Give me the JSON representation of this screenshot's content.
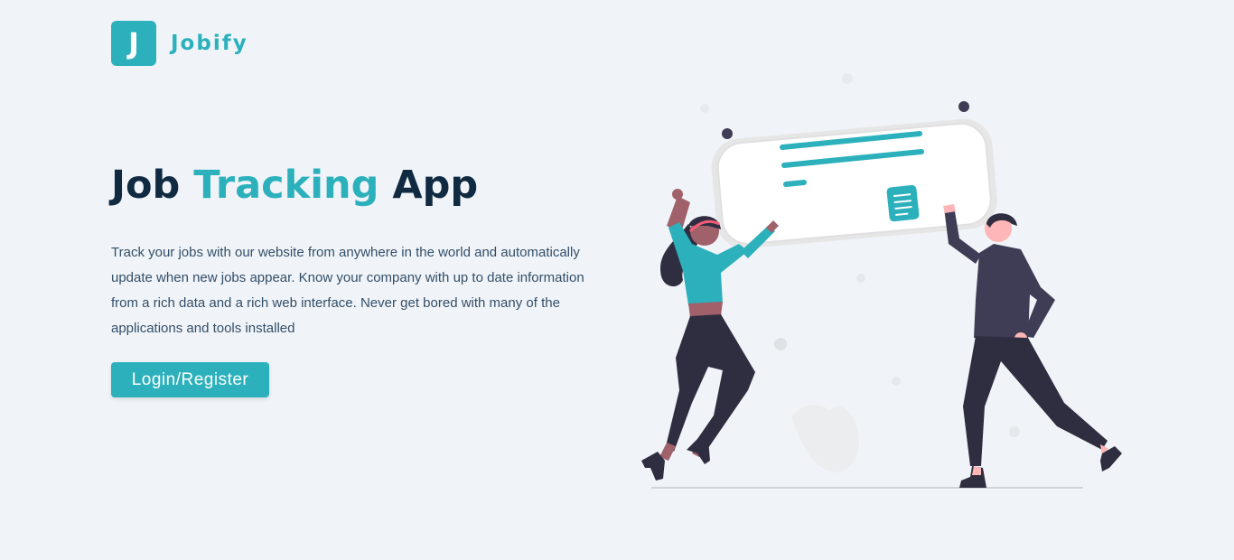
{
  "brand": {
    "logo_letter": "J",
    "name": "Jobify"
  },
  "hero": {
    "title_part1": "Job ",
    "title_accent": "Tracking",
    "title_part2": " App",
    "description": "Track your jobs with our website from anywhere in the world and automatically update when new jobs appear. Know your company with up to date information from a rich data and a rich web interface. Never get bored with many of the applications and tools installed",
    "button_label": "Login/Register"
  },
  "colors": {
    "primary": "#2cb1bc",
    "heading": "#102a42",
    "text": "#334e68",
    "background": "#f0f4f8"
  },
  "illustration": {
    "icon": "people-celebrating-illustration"
  }
}
